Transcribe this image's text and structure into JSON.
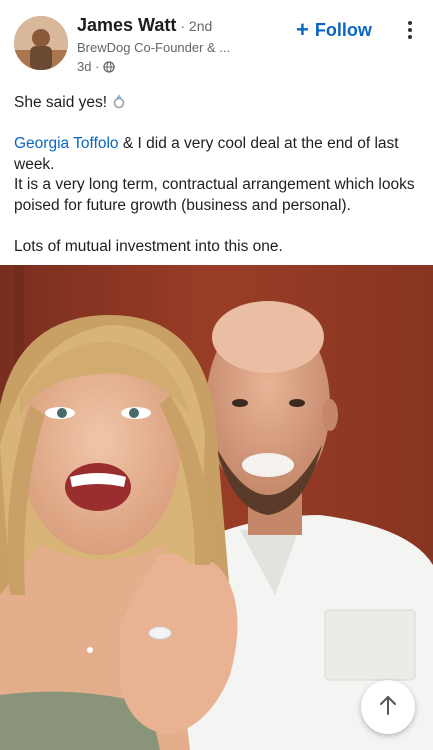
{
  "post": {
    "author": {
      "name": "James Watt",
      "degree": "· 2nd",
      "headline": "BrewDog Co-Founder & ...",
      "time": "3d ·",
      "visibility_icon": "globe-icon"
    },
    "follow_label": "Follow",
    "body": {
      "line1": "She said yes!",
      "mention": "Georgia Toffolo",
      "line2_rest": " & I did a very cool deal at the end of last week.",
      "line3": "It is a very long term, contractual arrangement which looks poised for future growth (business and personal).",
      "line4": "Lots of mutual investment into this one."
    },
    "image_icon": "engagement-photo"
  },
  "colors": {
    "accent": "#0a66c2",
    "text": "#1f1f1f",
    "muted": "#666666"
  },
  "icons": [
    "more-options-icon",
    "ring-emoji-icon",
    "arrow-up-icon",
    "plus-icon"
  ]
}
